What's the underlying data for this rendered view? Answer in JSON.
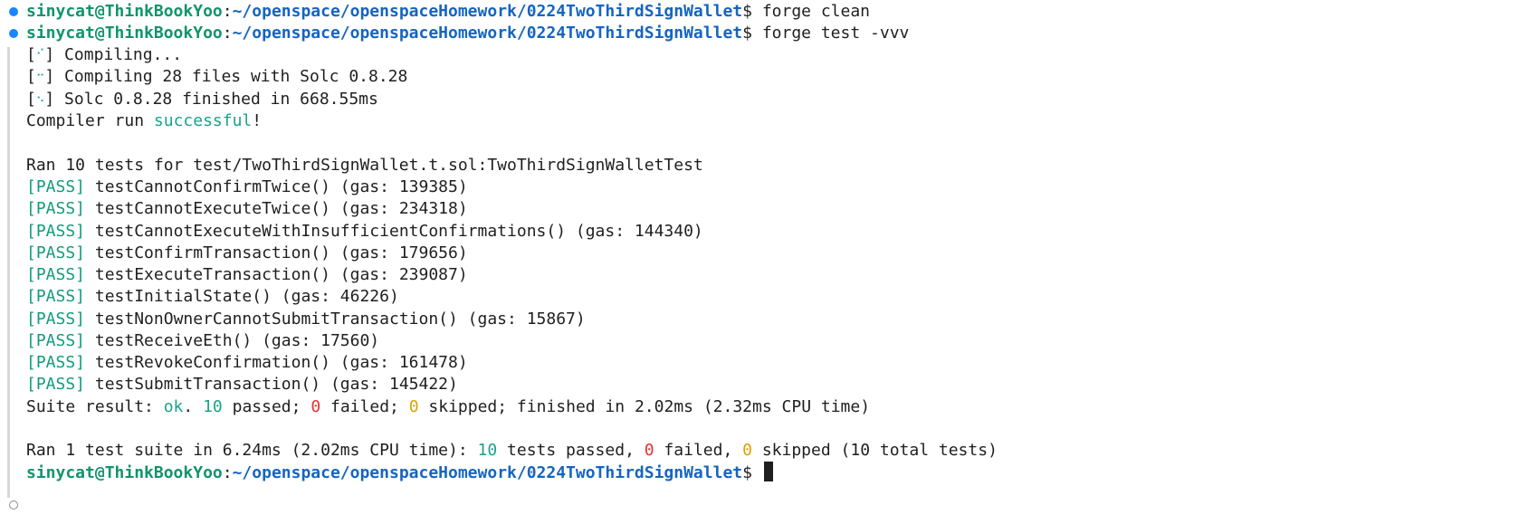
{
  "prompt": {
    "user_host": "sinycat@ThinkBookYoo",
    "separator": ":",
    "path": "~/openspace/openspaceHomework/0224TwoThirdSignWallet",
    "symbol": "$"
  },
  "commands": [
    "forge clean",
    "forge test -vvv"
  ],
  "compile": {
    "line1": " Compiling...",
    "line2": " Compiling 28 files with Solc 0.8.28",
    "line3": " Solc 0.8.28 finished in 668.55ms",
    "run_prefix": "Compiler run ",
    "run_status": "successful",
    "run_suffix": "!"
  },
  "suite_header": "Ran 10 tests for test/TwoThirdSignWallet.t.sol:TwoThirdSignWalletTest",
  "pass_tag": "[PASS]",
  "tests": [
    " testCannotConfirmTwice() (gas: 139385)",
    " testCannotExecuteTwice() (gas: 234318)",
    " testCannotExecuteWithInsufficientConfirmations() (gas: 144340)",
    " testConfirmTransaction() (gas: 179656)",
    " testExecuteTransaction() (gas: 239087)",
    " testInitialState() (gas: 46226)",
    " testNonOwnerCannotSubmitTransaction() (gas: 15867)",
    " testReceiveEth() (gas: 17560)",
    " testRevokeConfirmation() (gas: 161478)",
    " testSubmitTransaction() (gas: 145422)"
  ],
  "suite_result": {
    "prefix": "Suite result: ",
    "ok": "ok",
    "t1": ". ",
    "passed_n": "10",
    "t2": " passed; ",
    "failed_n": "0",
    "t3": " failed; ",
    "skipped_n": "0",
    "t4": " skipped; finished in 2.02ms (2.32ms CPU time)"
  },
  "summary": {
    "prefix": "Ran 1 test suite in 6.24ms (2.02ms CPU time): ",
    "passed_n": "10",
    "t1": " tests passed, ",
    "failed_n": "0",
    "t2": " failed, ",
    "skipped_n": "0",
    "t3": " skipped (10 total tests)"
  },
  "colors": {
    "user": "#11946b",
    "path": "#1565c0",
    "success": "#1aa38a",
    "failed": "#e8312f",
    "skipped": "#e0a100",
    "status_dot": "#1a85ff"
  }
}
